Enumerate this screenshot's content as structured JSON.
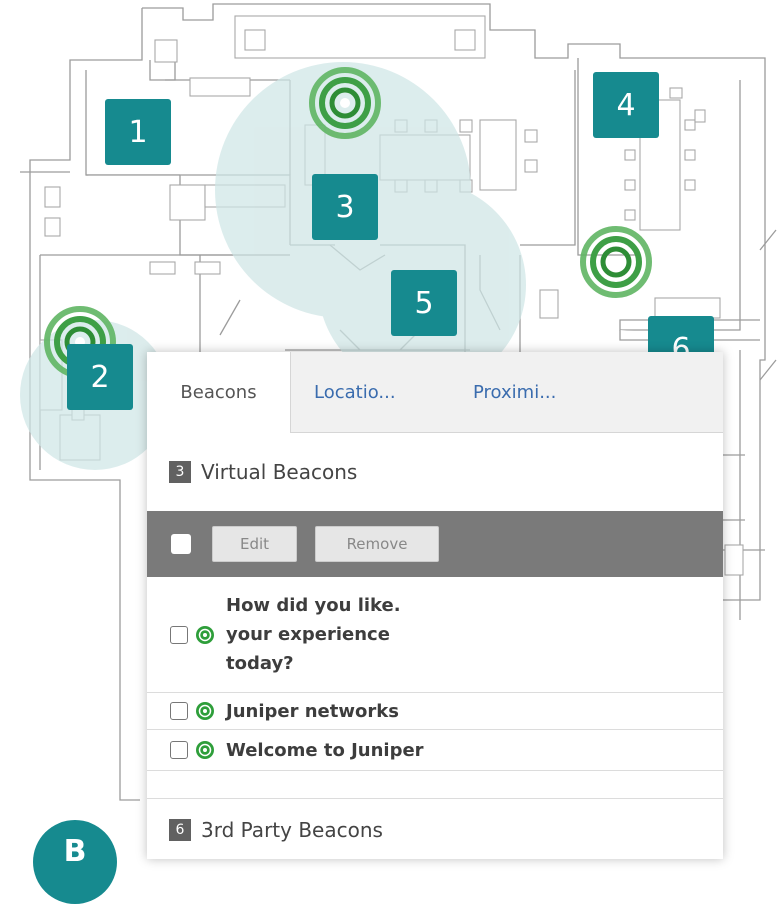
{
  "markers": [
    {
      "number": "1"
    },
    {
      "number": "2"
    },
    {
      "number": "3"
    },
    {
      "number": "4"
    },
    {
      "number": "5"
    },
    {
      "number": "6"
    },
    {
      "number": "B"
    }
  ],
  "tabs": [
    {
      "label": "Beacons",
      "active": true
    },
    {
      "label": "Locatio...",
      "active": false
    },
    {
      "label": "Proximi...",
      "active": false
    }
  ],
  "virtual_section": {
    "count": "3",
    "title": "Virtual Beacons"
  },
  "toolbar": {
    "edit_label": "Edit",
    "remove_label": "Remove"
  },
  "beacon_rows": [
    {
      "label": "How did you like. your experience today?",
      "icon": "beacon-signal-icon"
    },
    {
      "label": "Juniper networks",
      "icon": "beacon-signal-icon"
    },
    {
      "label": "Welcome to Juniper",
      "icon": "beacon-signal-icon"
    }
  ],
  "third_party_section": {
    "count": "6",
    "title": "3rd Party Beacons"
  },
  "colors": {
    "accent": "#168a8f",
    "beacon_green": "#2e9e3a",
    "toolbar": "#7a7a7a",
    "coverage": "#cfe6e6"
  }
}
